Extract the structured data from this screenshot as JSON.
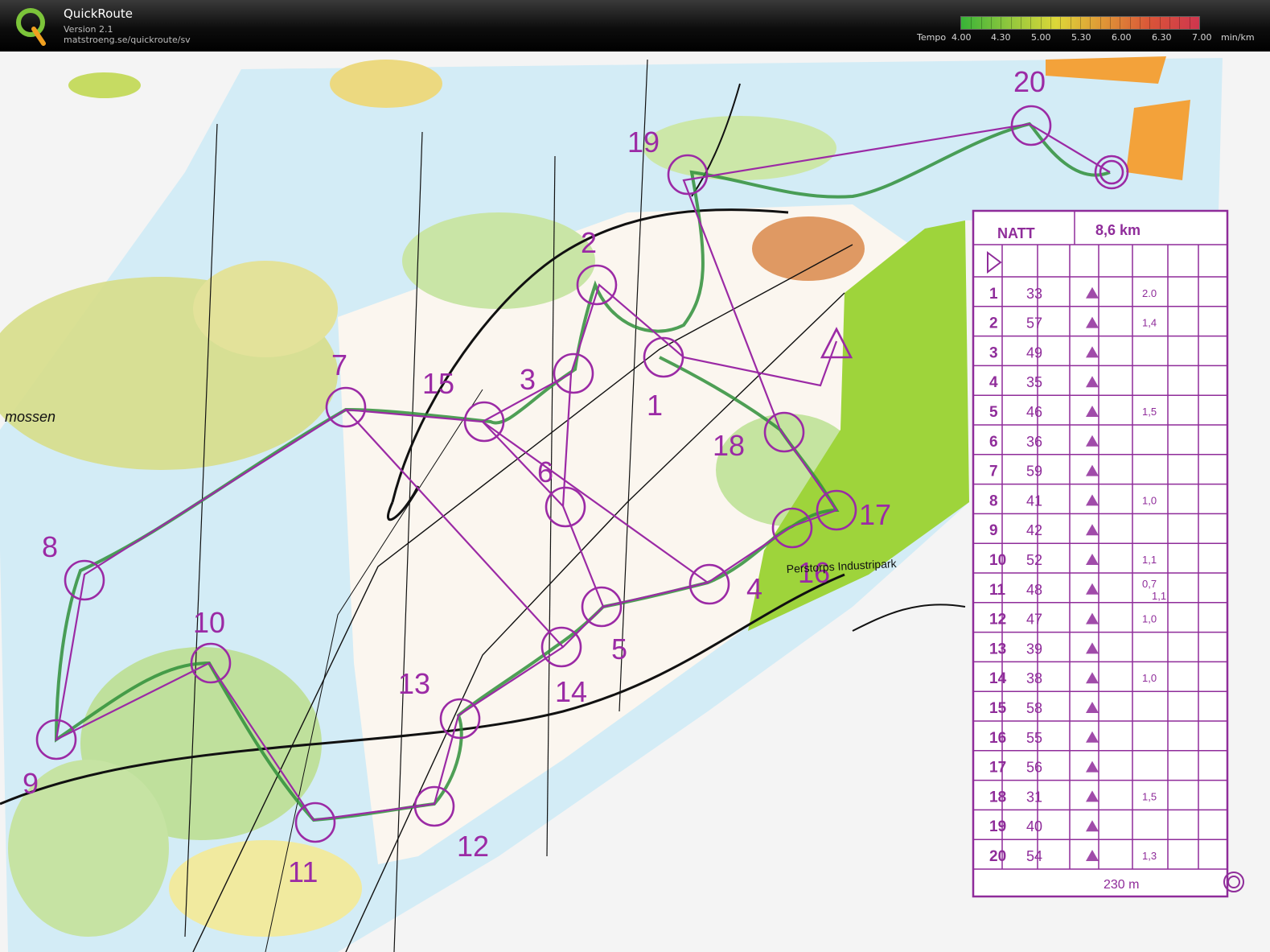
{
  "app": {
    "name": "QuickRoute",
    "version": "Version 2.1",
    "url": "matstroeng.se/quickroute/sv"
  },
  "tempo_legend": {
    "label": "Tempo",
    "unit": "min/km",
    "ticks": [
      "4.00",
      "4.30",
      "5.00",
      "5.30",
      "6.00",
      "6.30",
      "7.00"
    ],
    "colors": [
      "#3cc43c",
      "#9edb42",
      "#f3ec3d",
      "#f6a33a",
      "#ef5a3d",
      "#e33a55"
    ]
  },
  "map_labels": {
    "mossen": "mossen",
    "industripark": "Perstorps Industripark"
  },
  "controls": [
    "7",
    "15",
    "3",
    "2",
    "1",
    "19",
    "20",
    "18",
    "6",
    "17",
    "16",
    "4",
    "5",
    "8",
    "10",
    "13",
    "14",
    "9",
    "11",
    "12"
  ],
  "description_sheet": {
    "class": "NATT",
    "length": "8,6 km",
    "rows": [
      {
        "n": "1",
        "code": "33",
        "dist": "2.0"
      },
      {
        "n": "2",
        "code": "57",
        "dist": "1,4"
      },
      {
        "n": "3",
        "code": "49",
        "dist": ""
      },
      {
        "n": "4",
        "code": "35",
        "dist": ""
      },
      {
        "n": "5",
        "code": "46",
        "dist": "1,5"
      },
      {
        "n": "6",
        "code": "36",
        "dist": ""
      },
      {
        "n": "7",
        "code": "59",
        "dist": ""
      },
      {
        "n": "8",
        "code": "41",
        "dist": "1,0"
      },
      {
        "n": "9",
        "code": "42",
        "dist": ""
      },
      {
        "n": "10",
        "code": "52",
        "dist": "1,1"
      },
      {
        "n": "11",
        "code": "48",
        "dist": "0,7"
      },
      {
        "n": "12",
        "code": "47",
        "dist": "1,0"
      },
      {
        "n": "13",
        "code": "39",
        "dist": ""
      },
      {
        "n": "14",
        "code": "38",
        "dist": "1,0"
      },
      {
        "n": "15",
        "code": "58",
        "dist": ""
      },
      {
        "n": "16",
        "code": "55",
        "dist": ""
      },
      {
        "n": "17",
        "code": "56",
        "dist": ""
      },
      {
        "n": "18",
        "code": "31",
        "dist": "1,5"
      },
      {
        "n": "19",
        "code": "40",
        "dist": ""
      },
      {
        "n": "20",
        "code": "54",
        "dist": "1,3"
      }
    ],
    "dist_extra_11": "1,1",
    "finish_distance": "230 m"
  },
  "colors": {
    "course": "#9b2aa5",
    "forest_green": "#b3dc8a",
    "open_yellow": "#f2e79a",
    "water_blue": "#c4e6f4",
    "route_green": "#2f8f3a"
  }
}
